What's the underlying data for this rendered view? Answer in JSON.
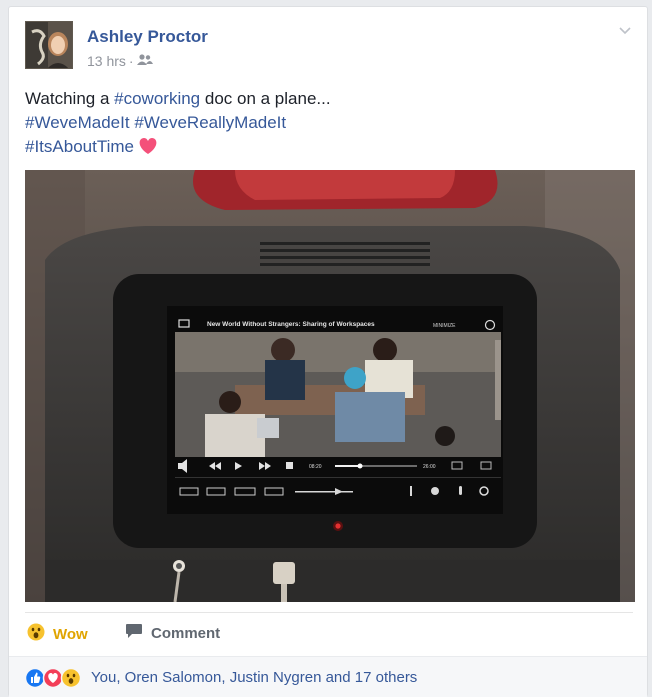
{
  "post": {
    "author": "Ashley Proctor",
    "timestamp": "13 hrs",
    "separator": "·",
    "audience_icon": "friends-icon",
    "text": {
      "line1_prefix": "Watching a ",
      "line1_tag": "#coworking",
      "line1_suffix": " doc on a plane...",
      "line2_tag_a": "#WeveMadeIt",
      "line2_tag_b": "#WeveReallyMadeIt",
      "line3_tag": "#ItsAboutTime"
    },
    "emoji_icon": "heart-icon"
  },
  "photo": {
    "screen_title": "New World Without Strangers: Sharing of Workspaces",
    "minimize_label": "MINIMIZE",
    "time_elapsed": "08:20",
    "time_total": "26:00"
  },
  "actions": {
    "wow_label": "Wow",
    "comment_label": "Comment"
  },
  "reactions": {
    "summary": "You, Oren Salomon, Justin Nygren and 17 others",
    "icons": [
      "like-icon",
      "love-icon",
      "wow-icon"
    ]
  },
  "colors": {
    "link_blue": "#365899",
    "wow_yellow": "#e0a400",
    "like_blue": "#1877f2",
    "love_red": "#f33e58",
    "background": "#e9ebee"
  }
}
